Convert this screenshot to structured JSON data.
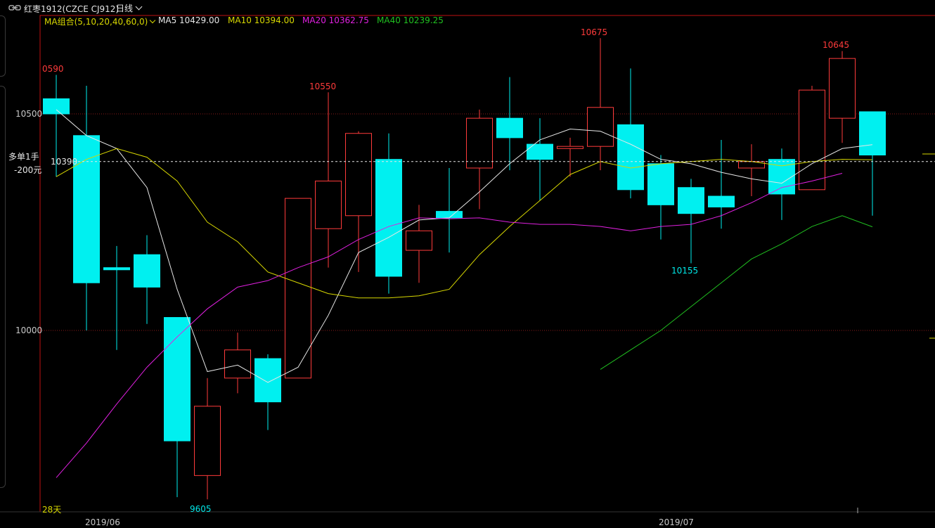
{
  "header": {
    "symbol": "红枣1912(CZCE CJ912)",
    "period": "日线"
  },
  "legend": {
    "ma_group": "MA组合(5,10,20,40,60,0)",
    "ma5": "MA5 10429.00",
    "ma10": "MA10 10394.00",
    "ma20": "MA20 10362.75",
    "ma40": "MA40 10239.25"
  },
  "colors": {
    "up": "#ff3b3b",
    "down": "#00f0f0",
    "ma5": "#e6e6e6",
    "ma10": "#d8d800",
    "ma20": "#e020e0",
    "ma40": "#20c020",
    "grid": "#8a1a1a",
    "frame": "#c01010"
  },
  "position": {
    "line1": "多单1手",
    "line2": "-200元",
    "price": "10390"
  },
  "y_ticks": [
    "10500",
    "10000"
  ],
  "x_ticks": [
    "2019/06",
    "2019/07"
  ],
  "day_count": "28天",
  "annotations": {
    "high1": "0590",
    "high2": "10550",
    "high3": "10675",
    "high4": "10645",
    "low1": "9605",
    "low2": "10155"
  },
  "chart_data": {
    "type": "candlestick",
    "ylim": [
      9590,
      10700
    ],
    "candles": [
      {
        "o": 10535,
        "c": 10500,
        "h": 10590,
        "l": 10355
      },
      {
        "o": 10450,
        "c": 10110,
        "h": 10565,
        "l": 10000
      },
      {
        "o": 10145,
        "c": 10140,
        "h": 10195,
        "l": 9955
      },
      {
        "o": 10175,
        "c": 10100,
        "h": 10220,
        "l": 10015
      },
      {
        "o": 10030,
        "c": 9745,
        "h": 10030,
        "l": 9615
      },
      {
        "o": 9665,
        "c": 9825,
        "h": 9890,
        "l": 9610
      },
      {
        "o": 9890,
        "c": 9955,
        "h": 9995,
        "l": 9855
      },
      {
        "o": 9935,
        "c": 9835,
        "h": 9945,
        "l": 9770
      },
      {
        "o": 9890,
        "c": 10305,
        "h": 10305,
        "l": 9890
      },
      {
        "o": 10235,
        "c": 10345,
        "h": 10550,
        "l": 10145
      },
      {
        "o": 10265,
        "c": 10455,
        "h": 10460,
        "l": 10135
      },
      {
        "o": 10395,
        "c": 10125,
        "h": 10455,
        "l": 10085
      },
      {
        "o": 10185,
        "c": 10230,
        "h": 10290,
        "l": 10110
      },
      {
        "o": 10275,
        "c": 10260,
        "h": 10375,
        "l": 10180
      },
      {
        "o": 10375,
        "c": 10490,
        "h": 10510,
        "l": 10280
      },
      {
        "o": 10490,
        "c": 10445,
        "h": 10585,
        "l": 10370
      },
      {
        "o": 10430,
        "c": 10395,
        "h": 10490,
        "l": 10300
      },
      {
        "o": 10420,
        "c": 10425,
        "h": 10445,
        "l": 10355
      },
      {
        "o": 10425,
        "c": 10515,
        "h": 10675,
        "l": 10370
      },
      {
        "o": 10475,
        "c": 10325,
        "h": 10605,
        "l": 10305
      },
      {
        "o": 10385,
        "c": 10290,
        "h": 10405,
        "l": 10210
      },
      {
        "o": 10330,
        "c": 10270,
        "h": 10350,
        "l": 10155
      },
      {
        "o": 10310,
        "c": 10285,
        "h": 10440,
        "l": 10235
      },
      {
        "o": 10375,
        "c": 10390,
        "h": 10430,
        "l": 10310
      },
      {
        "o": 10395,
        "c": 10315,
        "h": 10420,
        "l": 10255
      },
      {
        "o": 10325,
        "c": 10555,
        "h": 10565,
        "l": 10325
      },
      {
        "o": 10490,
        "c": 10628,
        "h": 10645,
        "l": 10433
      },
      {
        "o": 10505,
        "c": 10405,
        "h": 10505,
        "l": 10265
      }
    ],
    "ma5": [
      10510,
      10450,
      10420,
      10330,
      10095,
      9905,
      9920,
      9880,
      9915,
      10035,
      10180,
      10215,
      10255,
      10260,
      10320,
      10385,
      10440,
      10465,
      10460,
      10430,
      10395,
      10385,
      10365,
      10350,
      10340,
      10385,
      10420,
      10429
    ],
    "ma10": [
      10355,
      10395,
      10420,
      10400,
      10345,
      10250,
      10205,
      10135,
      10110,
      10085,
      10075,
      10075,
      10080,
      10095,
      10175,
      10240,
      10300,
      10360,
      10390,
      10375,
      10385,
      10390,
      10395,
      10390,
      10380,
      10390,
      10395,
      10394
    ],
    "ma20": [
      9660,
      9740,
      9830,
      9915,
      9985,
      10050,
      10100,
      10115,
      10145,
      10170,
      10210,
      10240,
      10260,
      10258,
      10260,
      10250,
      10245,
      10245,
      10240,
      10230,
      10240,
      10245,
      10265,
      10295,
      10330,
      10345,
      10362.75
    ],
    "ma40": [
      9910,
      9955,
      10000,
      10055,
      10110,
      10165,
      10200,
      10240,
      10265,
      10239.25
    ],
    "position_price": 10390
  }
}
